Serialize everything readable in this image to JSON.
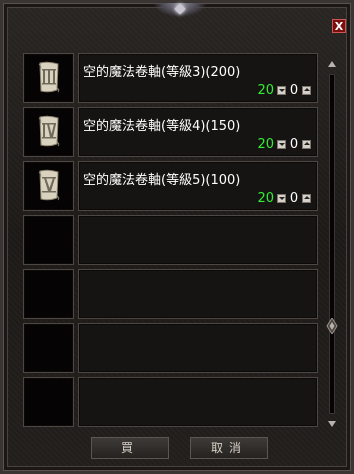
{
  "window": {
    "close_label": "X"
  },
  "items": [
    {
      "name": "空的魔法卷軸(等級3)(200)",
      "max": "20",
      "qty": "0",
      "icon": "scroll-level-3-icon",
      "numeral": "III"
    },
    {
      "name": "空的魔法卷軸(等級4)(150)",
      "max": "20",
      "qty": "0",
      "icon": "scroll-level-4-icon",
      "numeral": "IV"
    },
    {
      "name": "空的魔法卷軸(等級5)(100)",
      "max": "20",
      "qty": "0",
      "icon": "scroll-level-5-icon",
      "numeral": "V"
    }
  ],
  "buttons": {
    "buy_label": "買",
    "cancel_label": "取消"
  },
  "colors": {
    "max_quantity": "#33ee33",
    "item_name": "#ffffff"
  }
}
